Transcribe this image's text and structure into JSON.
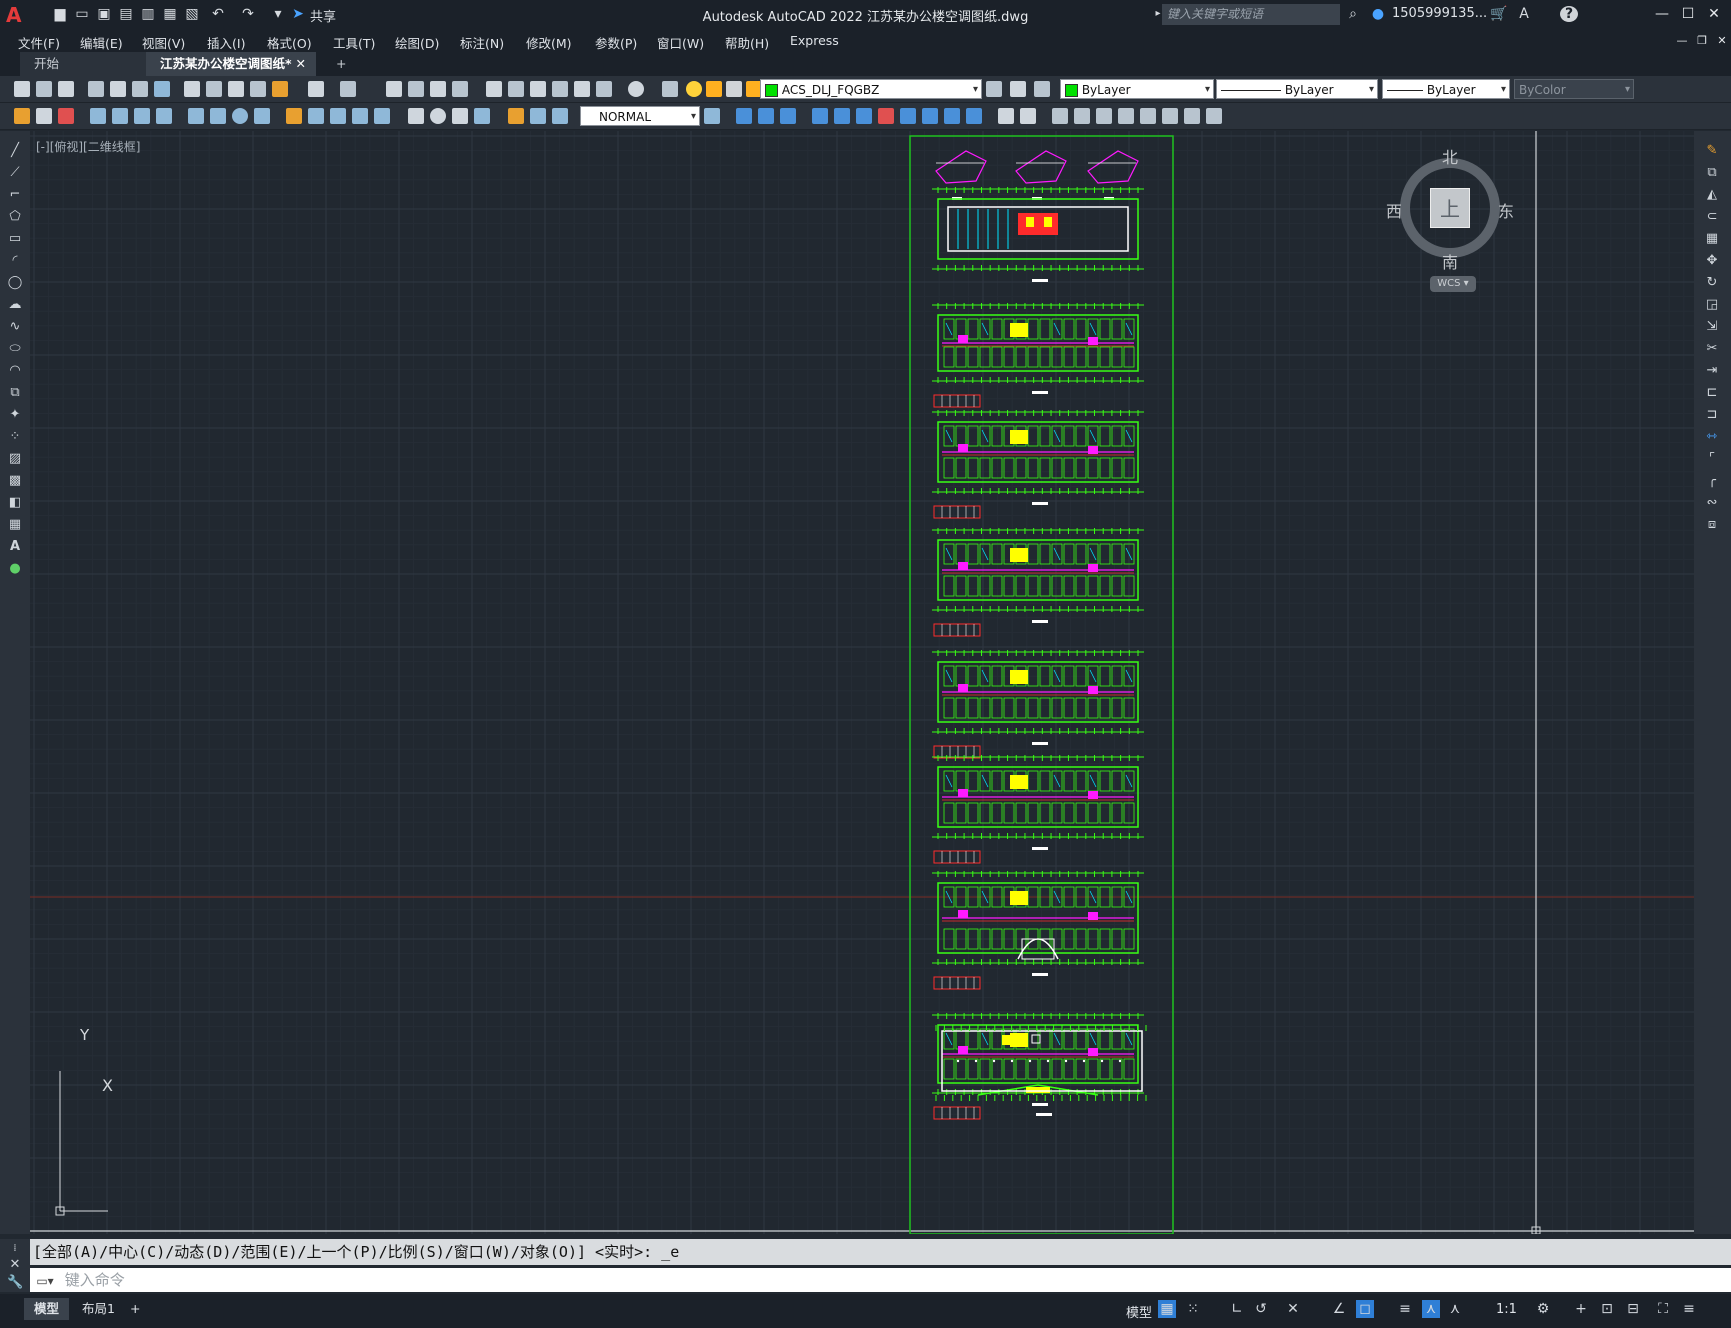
{
  "app": {
    "logo_label": "A",
    "window_title": "Autodesk AutoCAD 2022    江苏某办公楼空调图纸.dwg",
    "share_label": "共享",
    "search_placeholder": "键入关键字或短语",
    "user": "1505999135...",
    "help_label": "?"
  },
  "menus": [
    "文件(F)",
    "编辑(E)",
    "视图(V)",
    "插入(I)",
    "格式(O)",
    "工具(T)",
    "绘图(D)",
    "标注(N)",
    "修改(M)",
    "参数(P)",
    "窗口(W)",
    "帮助(H)",
    "Express"
  ],
  "tabs": [
    {
      "label": "开始"
    },
    {
      "label": "江苏某办公楼空调图纸*"
    },
    {
      "label": "+"
    }
  ],
  "toolbar": {
    "layer_name": "ACS_DLJ_FQGBZ",
    "color": "ByLayer",
    "linetype": "ByLayer",
    "lineweight": "ByLayer",
    "plotstyle": "ByColor",
    "dimstyle": "NORMAL"
  },
  "viewport": {
    "label": "[-][俯视][二维线框]",
    "viewcube": {
      "north": "北",
      "south": "南",
      "east": "东",
      "west": "西",
      "face": "上",
      "wcs": "WCS"
    },
    "ucs": {
      "y": "Y",
      "x": "X"
    }
  },
  "command": {
    "history": "[全部(A)/中心(C)/动态(D)/范围(E)/上一个(P)/比例(S)/窗口(W)/对象(O)] <实时>: _e",
    "placeholder": "键入命令"
  },
  "status": {
    "layout_tabs": [
      "模型",
      "布局1",
      "+"
    ],
    "model_label": "模型",
    "scale": "1:1"
  },
  "colors": {
    "canvas": "#212830",
    "drawing_green": "#39ff14",
    "frame_green": "#1fc21f",
    "accent_blue": "#2f7fd6"
  }
}
